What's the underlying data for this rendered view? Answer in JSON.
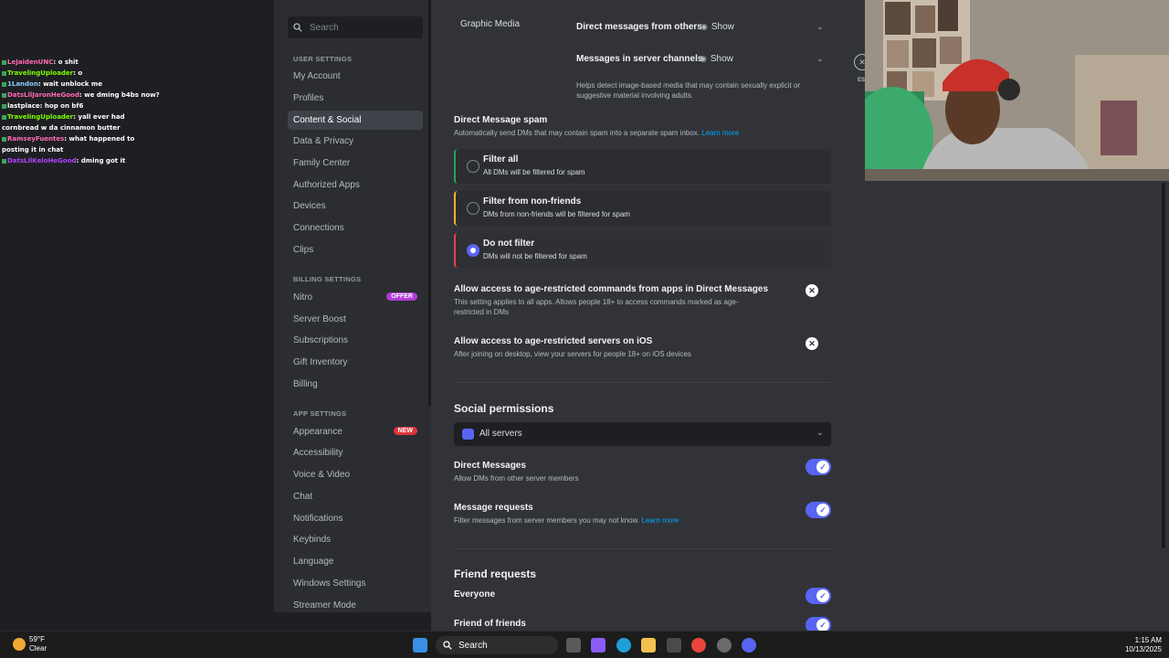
{
  "chat": [
    {
      "user": "LeJaidenUNC",
      "color": "#ff69b4",
      "msg": "o shit"
    },
    {
      "user": "TravelingUploader",
      "color": "#7cfc00",
      "msg": "o"
    },
    {
      "user": "1Landon",
      "color": "#87cefa",
      "msg": "wait unblock me"
    },
    {
      "user": "DatsLilJaronHeGood",
      "color": "#ff69b4",
      "msg": "we dming b4bs now?"
    },
    {
      "user": "lastplace",
      "color": "#ffffff",
      "msg": "hop on bf6"
    },
    {
      "user": "TravelingUploader",
      "color": "#7cfc00",
      "msg": "yall ever had cornbread w da cinnamon butter"
    },
    {
      "user": "RamseyFuentes",
      "color": "#ff69b4",
      "msg": "what happened to posting it in chat"
    },
    {
      "user": "DatsLilKeloHeGood",
      "color": "#b044ff",
      "msg": "dming got it"
    }
  ],
  "sidebar": {
    "search_placeholder": "Search",
    "user_settings_header": "USER SETTINGS",
    "user_items": [
      "My Account",
      "Profiles",
      "Content & Social",
      "Data & Privacy",
      "Family Center",
      "Authorized Apps",
      "Devices",
      "Connections",
      "Clips"
    ],
    "billing_header": "BILLING SETTINGS",
    "billing_items": [
      "Nitro",
      "Server Boost",
      "Subscriptions",
      "Gift Inventory",
      "Billing"
    ],
    "offer_tag": "OFFER",
    "app_header": "APP SETTINGS",
    "app_items": [
      "Appearance",
      "Accessibility",
      "Voice & Video",
      "Chat",
      "Notifications",
      "Keybinds",
      "Language",
      "Windows Settings",
      "Streamer Mode"
    ],
    "new_tag": "NEW"
  },
  "main": {
    "graphic_media": "Graphic Media",
    "dm_others_label": "Direct messages from others",
    "dm_others_value": "Show",
    "server_channels_label": "Messages in server channels",
    "server_channels_value": "Show",
    "graphic_desc": "Helps detect image-based media that may contain sexually explicit or suggestive material involving adults.",
    "dm_spam_title": "Direct Message spam",
    "dm_spam_desc": "Automatically send DMs that may contain spam into a separate spam inbox.",
    "learn_more": "Learn more",
    "filter_all_title": "Filter all",
    "filter_all_desc": "All DMs will be filtered for spam",
    "filter_nonfriends_title": "Filter from non-friends",
    "filter_nonfriends_desc": "DMs from non-friends will be filtered for spam",
    "no_filter_title": "Do not filter",
    "no_filter_desc": "DMs will not be filtered for spam",
    "age_cmd_title": "Allow access to age-restricted commands from apps in Direct Messages",
    "age_cmd_desc": "This setting applies to all apps. Allows people 18+ to access commands marked as age-restricted in DMs",
    "age_ios_title": "Allow access to age-restricted servers on iOS",
    "age_ios_desc": "After joining on desktop, view your servers for people 18+ on iOS devices",
    "social_title": "Social permissions",
    "all_servers": "All servers",
    "dm_title": "Direct Messages",
    "dm_desc": "Allow DMs from other server members",
    "msg_req_title": "Message requests",
    "msg_req_desc": "Filter messages from server members you may not know.",
    "friend_req_title": "Friend requests",
    "everyone": "Everyone",
    "friends_of_friends": "Friend of friends"
  },
  "cam": {
    "esc": "ESC"
  },
  "taskbar": {
    "temp": "59°F",
    "weather": "Clear",
    "search": "Search",
    "time": "1:15 AM",
    "date": "10/13/2025"
  }
}
